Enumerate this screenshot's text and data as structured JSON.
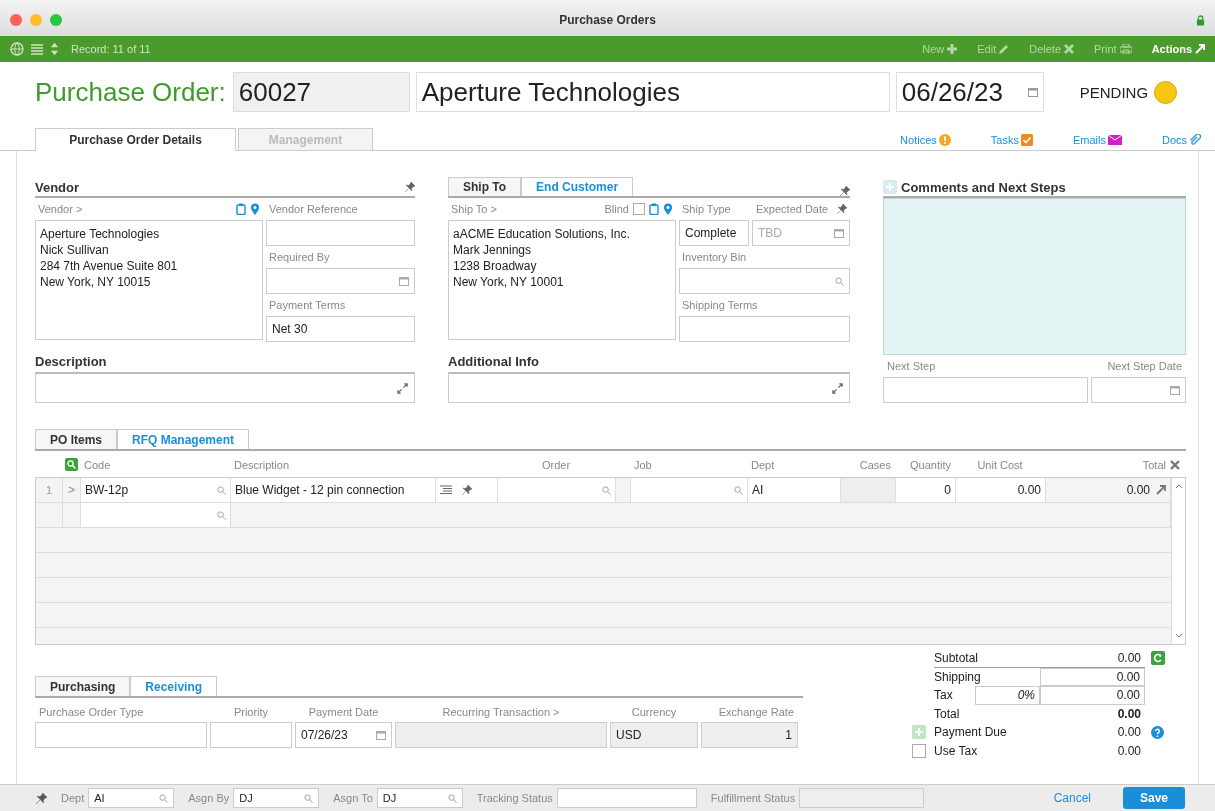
{
  "window": {
    "title": "Purchase Orders"
  },
  "toolbar": {
    "record": "Record: 11 of 11",
    "actions": [
      {
        "label": "New",
        "kind": "new",
        "disabled": true
      },
      {
        "label": "Edit",
        "kind": "edit",
        "disabled": true
      },
      {
        "label": "Delete",
        "kind": "delete",
        "disabled": true
      },
      {
        "label": "Print",
        "kind": "print",
        "disabled": true
      },
      {
        "label": "Actions",
        "kind": "actions",
        "disabled": false
      }
    ]
  },
  "header": {
    "label": "Purchase Order:",
    "number": "60027",
    "vendor": "Aperture Technologies",
    "date": "06/26/23",
    "status": "PENDING"
  },
  "tabs": [
    {
      "label": "Purchase Order Details",
      "selected": true,
      "disabled": false
    },
    {
      "label": "Management",
      "selected": false,
      "disabled": true
    }
  ],
  "links": [
    {
      "label": "Notices",
      "kind": "notices"
    },
    {
      "label": "Tasks",
      "kind": "tasks"
    },
    {
      "label": "Emails",
      "kind": "emails"
    },
    {
      "label": "Docs",
      "kind": "docs"
    }
  ],
  "vendor": {
    "title": "Vendor",
    "address_label": "Vendor >",
    "address": [
      "Aperture Technologies",
      "Nick Sullivan",
      "284 7th Avenue Suite 801",
      "New York, NY 10015"
    ],
    "fields": [
      {
        "label": "Vendor Reference",
        "kind": "text"
      },
      {
        "label": "Required By",
        "kind": "date"
      },
      {
        "label": "Payment Terms",
        "kind": "text",
        "value": "Net 30"
      }
    ]
  },
  "ship": {
    "tabs": [
      {
        "label": "Ship To",
        "selected": true
      },
      {
        "label": "End Customer",
        "selected": false
      }
    ],
    "address_label": "Ship To >",
    "blind": {
      "label": "Blind",
      "checked": false
    },
    "address": [
      "aACME Education Solutions, Inc.",
      "Mark Jennings",
      "1238 Broadway",
      "New York, NY 10001"
    ],
    "ship_type": {
      "label": "Ship Type",
      "value": "Complete"
    },
    "expected_date": {
      "label": "Expected Date",
      "placeholder": "TBD"
    },
    "fields": [
      {
        "label": "Inventory Bin",
        "kind": "search"
      },
      {
        "label": "Shipping Terms",
        "kind": "text"
      }
    ]
  },
  "comments": {
    "title": "Comments and Next Steps",
    "next_step": "Next Step",
    "next_step_date": "Next Step Date"
  },
  "description": {
    "title": "Description"
  },
  "additional_info": {
    "title": "Additional Info"
  },
  "items": {
    "tabs": [
      {
        "label": "PO Items",
        "selected": true
      },
      {
        "label": "RFQ Management",
        "selected": false
      }
    ],
    "columns": [
      "Code",
      "Description",
      "Order",
      "Job",
      "Dept",
      "Cases",
      "Quantity",
      "Unit Cost",
      "Total"
    ],
    "rows": [
      {
        "index": "1",
        "expander": ">",
        "code": "BW-12p",
        "description": "Blue Widget - 12 pin connection",
        "dept": "AI",
        "quantity": "0",
        "unit_cost": "0.00",
        "total": "0.00"
      }
    ]
  },
  "purchasing": {
    "tabs": [
      {
        "label": "Purchasing",
        "selected": true
      },
      {
        "label": "Receiving",
        "selected": false
      }
    ],
    "fields": [
      {
        "label": "Purchase Order Type",
        "kind": "text"
      },
      {
        "label": "Priority",
        "kind": "text"
      },
      {
        "label": "Payment Date",
        "kind": "date",
        "value": "07/26/23"
      },
      {
        "label": "Recurring Transaction >",
        "kind": "readonly"
      },
      {
        "label": "Currency",
        "kind": "readonly",
        "value": "USD"
      },
      {
        "label": "Exchange Rate",
        "kind": "number",
        "value": "1"
      }
    ]
  },
  "totals": {
    "subtotal": {
      "label": "Subtotal",
      "value": "0.00"
    },
    "shipping": {
      "label": "Shipping",
      "value": "0.00"
    },
    "tax": {
      "label": "Tax",
      "rate": "0%",
      "value": "0.00"
    },
    "total": {
      "label": "Total",
      "value": "0.00"
    },
    "payment_due": {
      "label": "Payment Due",
      "value": "0.00"
    },
    "use_tax": {
      "label": "Use Tax",
      "checked": false,
      "value": "0.00"
    }
  },
  "footer": {
    "fields": [
      {
        "label": "Dept",
        "value": "AI",
        "kind": "search"
      },
      {
        "label": "Asgn By",
        "value": "DJ",
        "kind": "search"
      },
      {
        "label": "Asgn To",
        "value": "DJ",
        "kind": "search"
      },
      {
        "label": "Tracking Status",
        "kind": "text"
      },
      {
        "label": "Fulfillment Status",
        "kind": "readonly"
      }
    ],
    "cancel": "Cancel",
    "save": "Save"
  }
}
